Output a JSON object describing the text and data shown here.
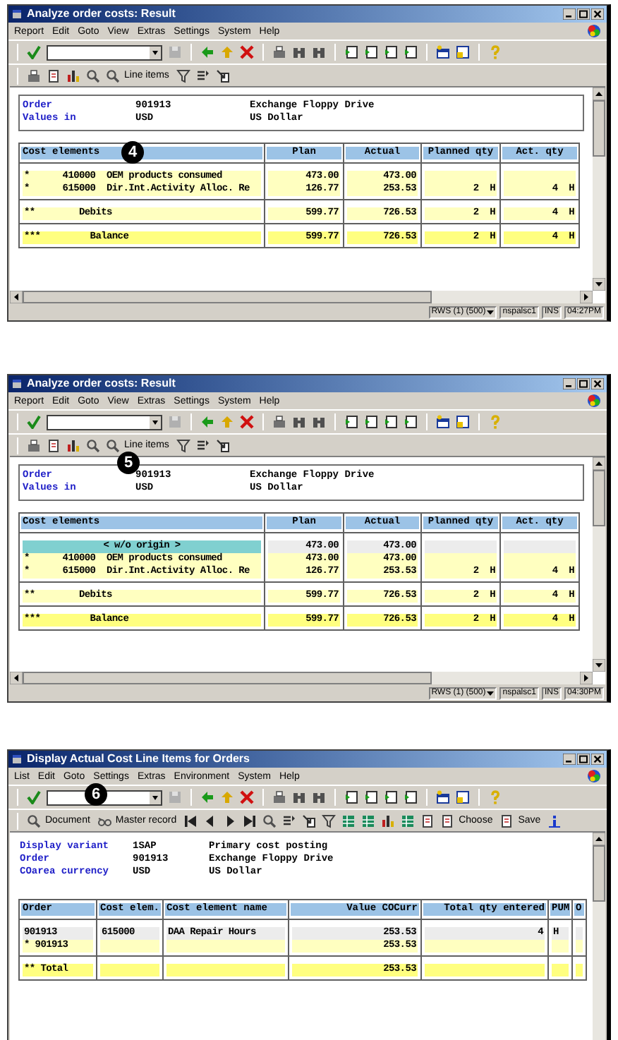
{
  "panels": [
    {
      "window": {
        "title": "Analyze order costs: Result"
      },
      "callout": "4",
      "menu": [
        "Report",
        "Edit",
        "Goto",
        "View",
        "Extras",
        "Settings",
        "System",
        "Help"
      ],
      "app_toolbar": [
        {
          "kind": "print"
        },
        {
          "kind": "document"
        },
        {
          "kind": "chart"
        },
        {
          "kind": "zoom"
        },
        {
          "kind": "zoom"
        },
        {
          "kind": "button",
          "label": "Line items"
        },
        {
          "kind": "filter"
        },
        {
          "kind": "list"
        },
        {
          "kind": "export"
        }
      ],
      "header": {
        "boxed": true,
        "lines": [
          {
            "label": "Order",
            "value": "901913",
            "text": "Exchange Floppy Drive"
          },
          {
            "label": "Values in",
            "value": "USD",
            "text": "US Dollar"
          }
        ]
      },
      "table": {
        "columns": [
          "Cost elements",
          "Plan",
          "Actual",
          "Planned qty",
          "Act. qty"
        ],
        "groups": [
          [
            {
              "kind": "item",
              "cells": [
                "*      410000  OEM products consumed",
                "473.00",
                "473.00",
                null,
                null
              ]
            },
            {
              "kind": "item",
              "cells": [
                "*      615000  Dir.Int.Activity Alloc. Re",
                "126.77",
                "253.53",
                "2  H",
                "4  H"
              ]
            }
          ],
          [
            {
              "kind": "subtotal",
              "cells": [
                "**        Debits",
                "599.77",
                "726.53",
                "2  H",
                "4  H"
              ]
            }
          ],
          [
            {
              "kind": "total",
              "cells": [
                "***         Balance",
                "599.77",
                "726.53",
                "2  H",
                "4  H"
              ]
            }
          ]
        ]
      },
      "status_bar": [
        "RWS (1) (500)",
        "nspalsc1",
        "INS",
        "04:27PM"
      ]
    },
    {
      "window": {
        "title": "Analyze order costs: Result"
      },
      "callout": "5",
      "menu": [
        "Report",
        "Edit",
        "Goto",
        "View",
        "Extras",
        "Settings",
        "System",
        "Help"
      ],
      "app_toolbar": [
        {
          "kind": "print"
        },
        {
          "kind": "document"
        },
        {
          "kind": "chart"
        },
        {
          "kind": "zoom"
        },
        {
          "kind": "zoom"
        },
        {
          "kind": "button",
          "label": "Line items"
        },
        {
          "kind": "filter"
        },
        {
          "kind": "list"
        },
        {
          "kind": "export"
        }
      ],
      "header": {
        "boxed": true,
        "lines": [
          {
            "label": "Order",
            "value": "901913",
            "text": "Exchange Floppy Drive"
          },
          {
            "label": "Values in",
            "value": "USD",
            "text": "US Dollar"
          }
        ]
      },
      "table": {
        "columns": [
          "Cost elements",
          "Plan",
          "Actual",
          "Planned qty",
          "Act. qty"
        ],
        "groups": [
          [
            {
              "kind": "origin",
              "cells": [
                "< w/o origin >",
                "473.00",
                "473.00",
                null,
                null
              ]
            },
            {
              "kind": "item",
              "cells": [
                "*      410000  OEM products consumed",
                "473.00",
                "473.00",
                null,
                null
              ]
            },
            {
              "kind": "item",
              "cells": [
                "*      615000  Dir.Int.Activity Alloc. Re",
                "126.77",
                "253.53",
                "2  H",
                "4  H"
              ]
            }
          ],
          [
            {
              "kind": "subtotal",
              "cells": [
                "**        Debits",
                "599.77",
                "726.53",
                "2  H",
                "4  H"
              ]
            }
          ],
          [
            {
              "kind": "total",
              "cells": [
                "***         Balance",
                "599.77",
                "726.53",
                "2  H",
                "4  H"
              ]
            }
          ]
        ]
      },
      "status_bar": [
        "RWS (1) (500)",
        "nspalsc1",
        "INS",
        "04:30PM"
      ]
    },
    {
      "window": {
        "title": "Display Actual Cost Line Items for Orders"
      },
      "callout": "6",
      "menu": [
        "List",
        "Edit",
        "Goto",
        "Settings",
        "Extras",
        "Environment",
        "System",
        "Help"
      ],
      "app_toolbar": [
        {
          "kind": "zoom"
        },
        {
          "kind": "button",
          "label": "Document"
        },
        {
          "kind": "glasses"
        },
        {
          "kind": "button",
          "label": "Master record"
        },
        {
          "kind": "first"
        },
        {
          "kind": "prev"
        },
        {
          "kind": "next"
        },
        {
          "kind": "last"
        },
        {
          "kind": "zoom"
        },
        {
          "kind": "list"
        },
        {
          "kind": "export"
        },
        {
          "kind": "filter"
        },
        {
          "kind": "grid"
        },
        {
          "kind": "grid"
        },
        {
          "kind": "chart"
        },
        {
          "kind": "grid"
        },
        {
          "kind": "document"
        },
        {
          "kind": "document"
        },
        {
          "kind": "button",
          "label": "Choose"
        },
        {
          "kind": "document"
        },
        {
          "kind": "button",
          "label": "Save"
        },
        {
          "kind": "info"
        }
      ],
      "header": {
        "boxed": false,
        "lines": [
          {
            "label": "Display variant",
            "value": "1SAP",
            "text": "Primary cost posting"
          },
          {
            "label": "Order",
            "value": "901913",
            "text": "Exchange Floppy Drive"
          },
          {
            "label": "COarea currency",
            "value": "USD",
            "text": "US Dollar"
          }
        ]
      },
      "table": {
        "columns": [
          "Order",
          "Cost elem.",
          "Cost element name",
          "Value COCurr",
          "Total qty entered",
          "PUM",
          "O"
        ],
        "groups": [
          [
            {
              "kind": "line",
              "cells": [
                "901913",
                "615000",
                "DAA Repair Hours",
                "253.53",
                "4",
                "H",
                null
              ]
            },
            {
              "kind": "subtotal",
              "cells": [
                "* 901913",
                null,
                null,
                "253.53",
                null,
                null,
                null
              ]
            }
          ],
          [
            {
              "kind": "total",
              "cells": [
                "** Total",
                null,
                null,
                "253.53",
                null,
                null,
                null
              ]
            }
          ]
        ]
      }
    }
  ]
}
